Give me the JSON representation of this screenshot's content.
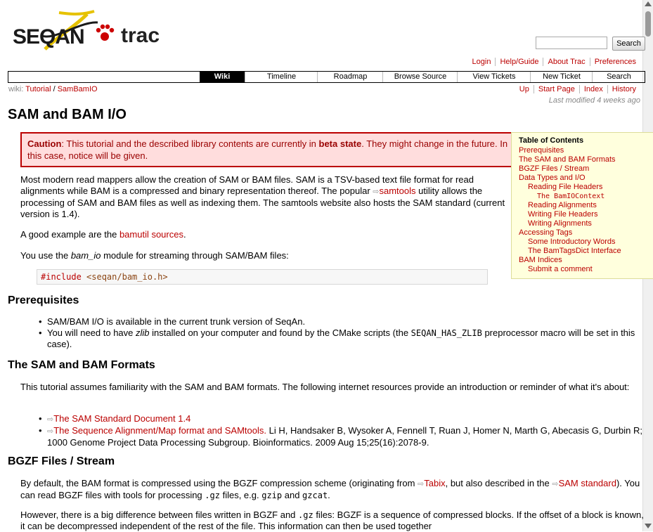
{
  "header": {
    "logo_text": "SEQAN",
    "logo_trac": "trac",
    "search_button": "Search"
  },
  "metanav": [
    "Login",
    "Help/Guide",
    "About Trac",
    "Preferences"
  ],
  "mainnav": [
    {
      "label": "Wiki",
      "active": true
    },
    {
      "label": "Timeline"
    },
    {
      "label": "Roadmap"
    },
    {
      "label": "Browse Source"
    },
    {
      "label": "View Tickets"
    },
    {
      "label": "New Ticket"
    },
    {
      "label": "Search"
    }
  ],
  "breadcrumb": {
    "prefix": "wiki:",
    "items": [
      "Tutorial",
      "SamBamIO"
    ]
  },
  "ctxnav": [
    "Up",
    "Start Page",
    "Index",
    "History"
  ],
  "last_modified": {
    "label": "Last modified",
    "ago": "4 weeks ago"
  },
  "page": {
    "title": "SAM and BAM I/O",
    "caution_label": "Caution",
    "caution_pre": ": This tutorial and the described library contents are currently in ",
    "caution_bold": "beta state",
    "caution_post": ". They might change in the future. In this case, notice will be given.",
    "p1_a": "Most modern read mappers allow the creation of SAM or BAM files. SAM is a TSV-based text file format for read alignments while BAM is a compressed and binary representation thereof. The popular ",
    "p1_link": "samtools",
    "p1_b": " utility allows the processing of SAM and BAM files as well as indexing them. The samtools website also hosts the SAM standard (current version is 1.4).",
    "p2_a": "A good example are the ",
    "p2_link": "bamutil sources",
    "p2_b": ".",
    "p3_a": "You use the ",
    "p3_em": "bam_io",
    "p3_b": " module for streaming through SAM/BAM files:",
    "code_directive": "#include",
    "code_header": "<seqan/bam_io.h>",
    "h_prereq": "Prerequisites",
    "prereq_1": "SAM/BAM I/O is available in the current trunk version of SeqAn.",
    "prereq_2_a": "You will need to have ",
    "prereq_2_em": "zlib",
    "prereq_2_b": " installed on your computer and found by the CMake scripts (the ",
    "prereq_2_code": "SEQAN_HAS_ZLIB",
    "prereq_2_c": " preprocessor macro will be set in this case).",
    "h_formats": "The SAM and BAM Formats",
    "formats_p": "This tutorial assumes familiarity with the SAM and BAM formats. The following internet resources provide an introduction or reminder of what it's about:",
    "formats_link1": "The SAM Standard Document 1.4",
    "formats_link2": "The Sequence Alignment/Map format and SAMtools.",
    "formats_cite": " Li H, Handsaker B, Wysoker A, Fennell T, Ruan J, Homer N, Marth G, Abecasis G, Durbin R; 1000 Genome Project Data Processing Subgroup. Bioinformatics. 2009 Aug 15;25(16):2078-9.",
    "h_bgzf": "BGZF Files / Stream",
    "bgzf_p1_a": "By default, the BAM format is compressed using the BGZF compression scheme (originating from ",
    "bgzf_p1_link1": "Tabix",
    "bgzf_p1_b": ", but also described in the ",
    "bgzf_p1_link2": "SAM standard",
    "bgzf_p1_c": "). You can read BGZF files with tools for processing ",
    "bgzf_p1_code1": ".gz",
    "bgzf_p1_d": " files, e.g. ",
    "bgzf_p1_code2": "gzip",
    "bgzf_p1_e": " and ",
    "bgzf_p1_code3": "gzcat",
    "bgzf_p1_f": ".",
    "bgzf_p2_a": "However, there is a big difference between files written in BGZF and ",
    "bgzf_p2_code": ".gz",
    "bgzf_p2_b": " files: BGZF is a sequence of compressed blocks. If the offset of a block is known, it can be decompressed independent of the rest of the file. This information can then be used together"
  },
  "toc": {
    "title": "Table of Contents",
    "items": [
      {
        "label": "Prerequisites",
        "level": 1
      },
      {
        "label": "The SAM and BAM Formats",
        "level": 1
      },
      {
        "label": "BGZF Files / Stream",
        "level": 1
      },
      {
        "label": "Data Types and I/O",
        "level": 1
      },
      {
        "label": "Reading File Headers",
        "level": 2
      },
      {
        "label": "The BamIOContext",
        "level": 3
      },
      {
        "label": "Reading Alignments",
        "level": 2
      },
      {
        "label": "Writing File Headers",
        "level": 2
      },
      {
        "label": "Writing Alignments",
        "level": 2
      },
      {
        "label": "Accessing Tags",
        "level": 1
      },
      {
        "label": "Some Introductory Words",
        "level": 2
      },
      {
        "label": "The BamTagsDict Interface",
        "level": 2
      },
      {
        "label": "BAM Indices",
        "level": 1
      },
      {
        "label": "Submit a comment",
        "level": 2
      }
    ]
  }
}
